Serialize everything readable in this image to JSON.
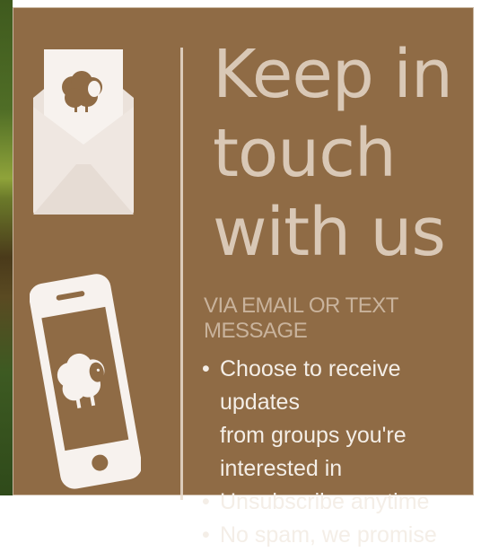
{
  "headline": {
    "line1": "Keep in",
    "line2": "touch",
    "line3": "with us"
  },
  "subheading": "VIA EMAIL OR TEXT MESSAGE",
  "bullets": [
    {
      "line1": "Choose to receive updates",
      "line2": "from groups you're interested in"
    },
    {
      "line1": "Unsubscribe anytime"
    },
    {
      "line1": "No spam, we promise"
    }
  ],
  "icons": {
    "envelope": "envelope-with-sheep-letter-icon",
    "phone": "smartphone-with-sheep-icon"
  },
  "colors": {
    "card_background": "#8f6b45",
    "headline": "#d9c8b6",
    "bullet_text": "#f4eee7"
  }
}
